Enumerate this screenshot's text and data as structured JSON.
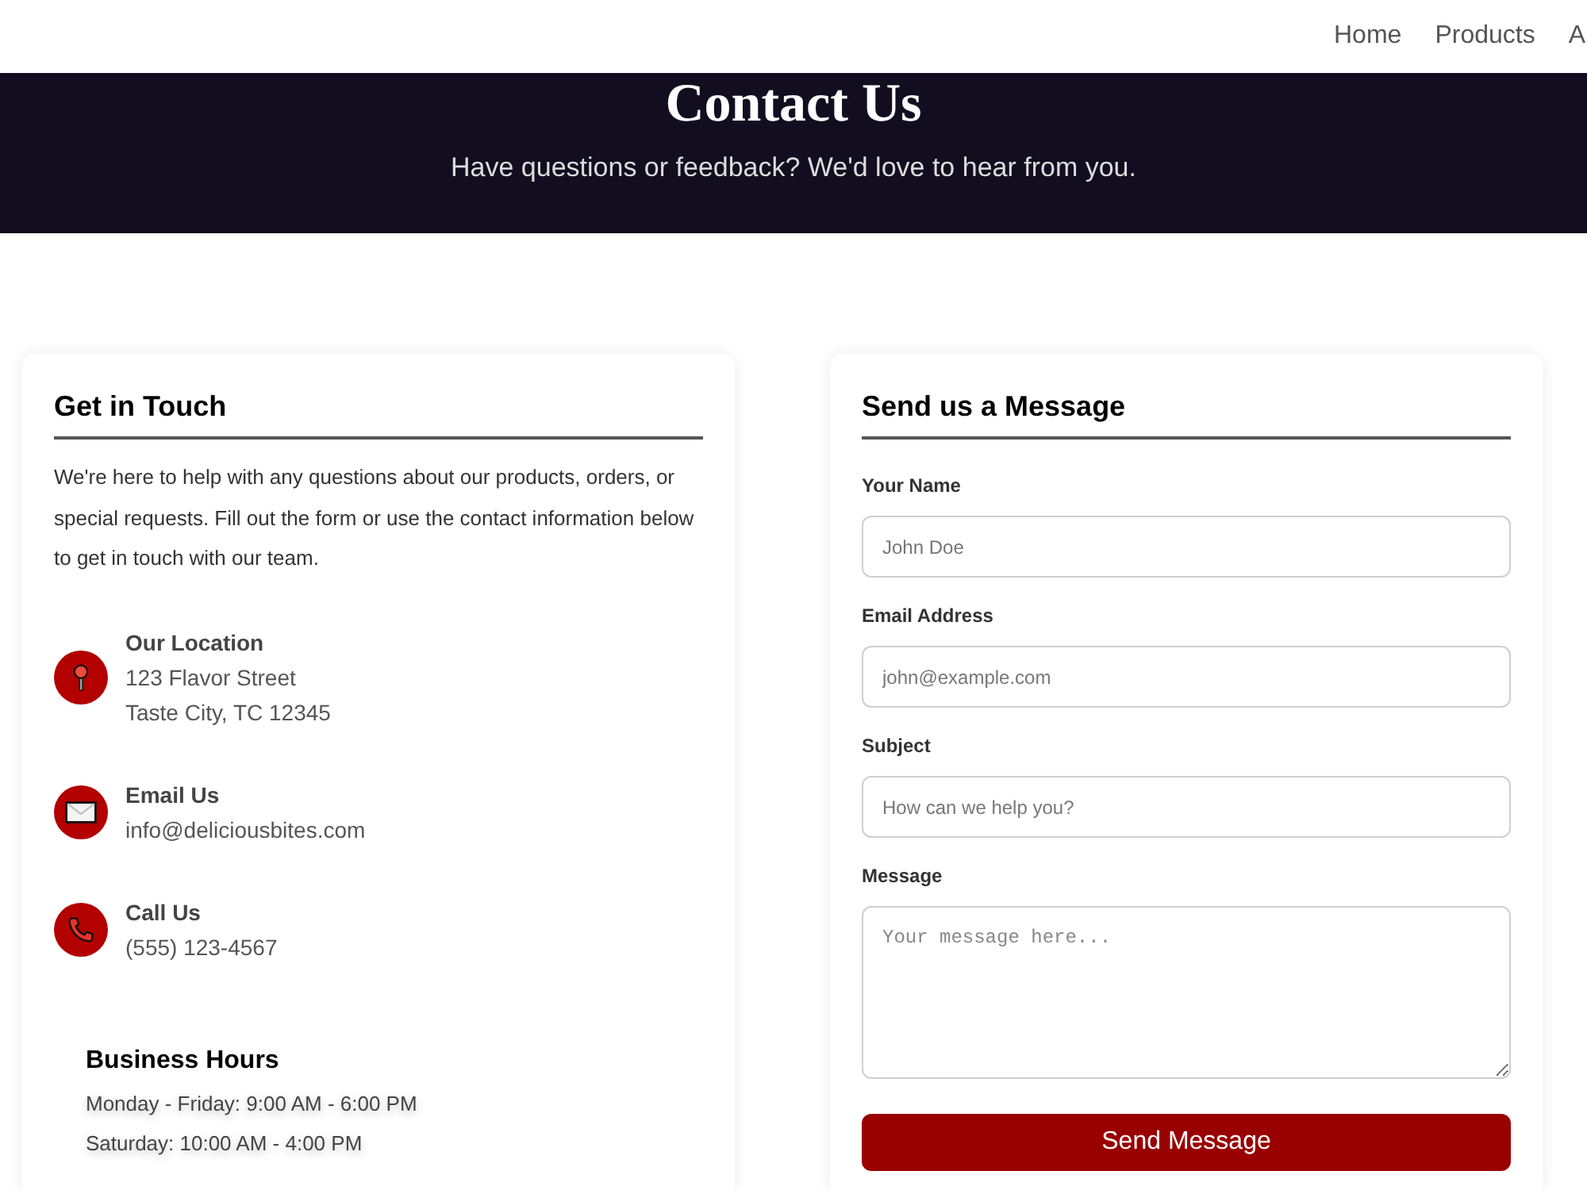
{
  "header": {
    "nav": [
      {
        "label": "Home"
      },
      {
        "label": "Products"
      },
      {
        "label": "A"
      }
    ]
  },
  "hero": {
    "title": "Contact Us",
    "subtitle": "Have questions or feedback? We'd love to hear from you."
  },
  "info_card": {
    "title": "Get in Touch",
    "intro": "We're here to help with any questions about our products, orders, or special requests. Fill out the form or use the contact information below to get in touch with our team.",
    "contacts": [
      {
        "kind": "location",
        "title": "Our Location",
        "lines": [
          "123 Flavor Street",
          "Taste City, TC 12345"
        ]
      },
      {
        "kind": "email",
        "title": "Email Us",
        "lines": [
          "info@deliciousbites.com"
        ]
      },
      {
        "kind": "phone",
        "title": "Call Us",
        "lines": [
          "(555) 123-4567"
        ]
      }
    ],
    "hours": {
      "title": "Business Hours",
      "lines": [
        "Monday - Friday: 9:00 AM - 6:00 PM",
        "Saturday: 10:00 AM - 4:00 PM"
      ]
    }
  },
  "form_card": {
    "title": "Send us a Message",
    "fields": [
      {
        "kind": "input",
        "label": "Your Name",
        "placeholder": "John Doe"
      },
      {
        "kind": "input",
        "label": "Email Address",
        "placeholder": "john@example.com"
      },
      {
        "kind": "input",
        "label": "Subject",
        "placeholder": "How can we help you?"
      },
      {
        "kind": "textarea",
        "label": "Message",
        "placeholder": "Your message here..."
      }
    ],
    "submit": "Send Message"
  }
}
